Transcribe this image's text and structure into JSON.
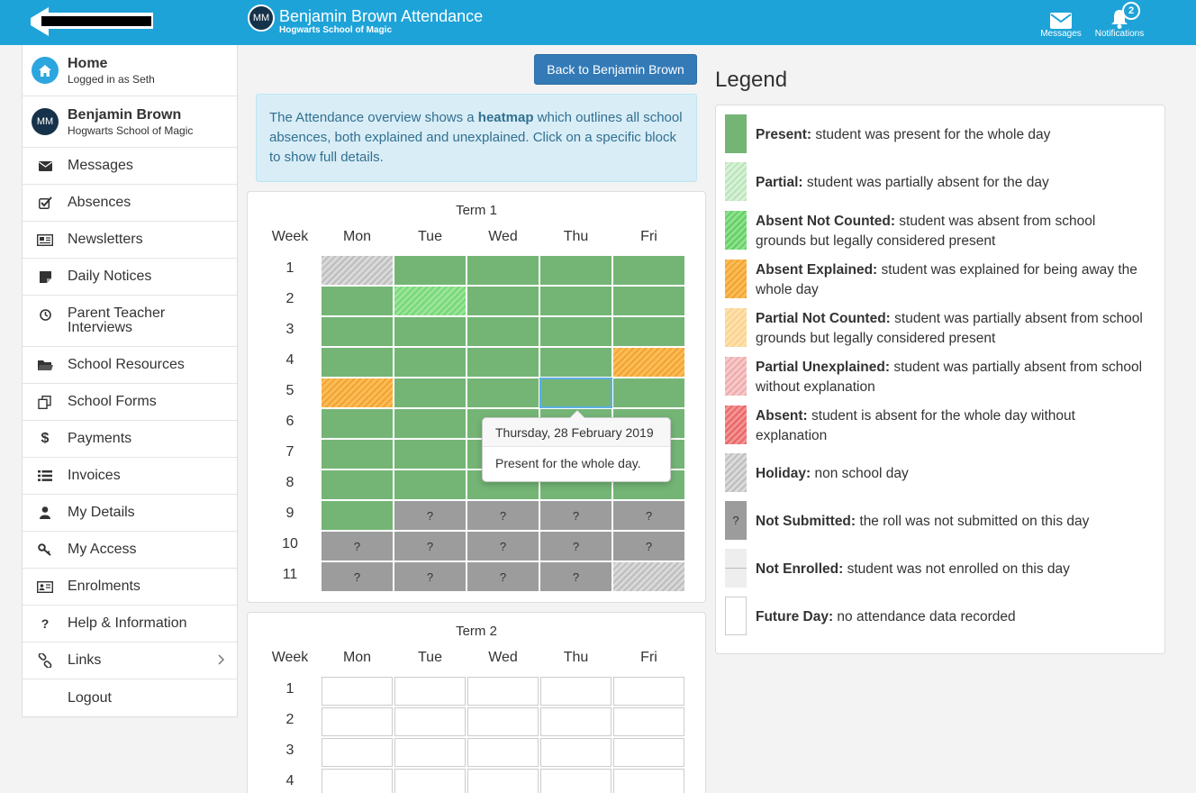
{
  "header": {
    "avatar_initials": "MM",
    "title": "Benjamin Brown Attendance",
    "subtitle": "Hogwarts School of Magic",
    "messages_label": "Messages",
    "notifications_label": "Notifications",
    "notifications_count": "2",
    "accent_color": "#1ea3d8"
  },
  "sidebar": {
    "home": {
      "title": "Home",
      "sub": "Logged in as Seth",
      "icon": "home-icon"
    },
    "student": {
      "initials": "MM",
      "name": "Benjamin Brown",
      "school": "Hogwarts School of Magic"
    },
    "items": [
      {
        "label": "Messages",
        "icon": "envelope-icon"
      },
      {
        "label": "Absences",
        "icon": "checkbox-icon"
      },
      {
        "label": "Newsletters",
        "icon": "newspaper-icon"
      },
      {
        "label": "Daily Notices",
        "icon": "note-icon"
      },
      {
        "label": "Parent Teacher Interviews",
        "icon": "clock-icon"
      },
      {
        "label": "School Resources",
        "icon": "folder-icon"
      },
      {
        "label": "School Forms",
        "icon": "forms-icon"
      },
      {
        "label": "Payments",
        "icon": "dollar-icon"
      },
      {
        "label": "Invoices",
        "icon": "list-icon"
      },
      {
        "label": "My Details",
        "icon": "user-icon"
      },
      {
        "label": "My Access",
        "icon": "key-icon"
      },
      {
        "label": "Enrolments",
        "icon": "id-card-icon"
      },
      {
        "label": "Help & Information",
        "icon": "question-icon"
      },
      {
        "label": "Links",
        "icon": "link-icon"
      },
      {
        "label": "Logout",
        "icon": ""
      }
    ]
  },
  "main": {
    "back_button": "Back to Benjamin Brown",
    "info_pre": "The Attendance overview shows a ",
    "info_bold": "heatmap",
    "info_post": " which outlines all school absences, both explained and unexplained. Click on a specific block to show full details.",
    "week_header": "Week",
    "days": [
      "Mon",
      "Tue",
      "Wed",
      "Thu",
      "Fri"
    ],
    "term1": {
      "title": "Term 1",
      "weeks": [
        "1",
        "2",
        "3",
        "4",
        "5",
        "6",
        "7",
        "8",
        "9",
        "10",
        "11"
      ],
      "status": [
        [
          "holiday",
          "present",
          "present",
          "present",
          "present"
        ],
        [
          "present",
          "partial",
          "present",
          "present",
          "present"
        ],
        [
          "present",
          "present",
          "present",
          "present",
          "present"
        ],
        [
          "present",
          "present",
          "present",
          "present",
          "explained"
        ],
        [
          "explained",
          "present",
          "present",
          "present",
          "present"
        ],
        [
          "present",
          "present",
          "present",
          "present",
          "present"
        ],
        [
          "present",
          "present",
          "present",
          "present",
          "present"
        ],
        [
          "present",
          "present",
          "present",
          "present",
          "present"
        ],
        [
          "present",
          "notsub",
          "notsub",
          "notsub",
          "notsub"
        ],
        [
          "notsub",
          "notsub",
          "notsub",
          "notsub",
          "notsub"
        ],
        [
          "notsub",
          "notsub",
          "notsub",
          "notsub",
          "holiday"
        ]
      ],
      "not_submitted_mark": "?"
    },
    "term2": {
      "title": "Term 2",
      "weeks": [
        "1",
        "2",
        "3",
        "4"
      ]
    },
    "tooltip": {
      "date": "Thursday, 28 February 2019",
      "text": "Present for the whole day."
    }
  },
  "legend": {
    "title": "Legend",
    "items": [
      {
        "term": "Present:",
        "desc": " student was present for the whole day",
        "mark": ""
      },
      {
        "term": "Partial:",
        "desc": " student was partially absent for the day",
        "mark": ""
      },
      {
        "term": "Absent Not Counted:",
        "desc": " student was absent from school grounds but legally considered present",
        "mark": ""
      },
      {
        "term": "Absent Explained:",
        "desc": " student was explained for being away the whole day",
        "mark": ""
      },
      {
        "term": "Partial Not Counted:",
        "desc": " student was partially absent from school grounds but legally considered present",
        "mark": ""
      },
      {
        "term": "Partial Unexplained:",
        "desc": " student was partially absent from school without explanation",
        "mark": ""
      },
      {
        "term": "Absent:",
        "desc": " student is absent for the whole day without explanation",
        "mark": ""
      },
      {
        "term": "Holiday:",
        "desc": " non school day",
        "mark": ""
      },
      {
        "term": "Not Submitted:",
        "desc": " the roll was not submitted on this day",
        "mark": "?"
      },
      {
        "term": "Not Enrolled:",
        "desc": " student was not enrolled on this day",
        "mark": ""
      },
      {
        "term": "Future Day:",
        "desc": " no attendance data recorded",
        "mark": ""
      }
    ]
  }
}
